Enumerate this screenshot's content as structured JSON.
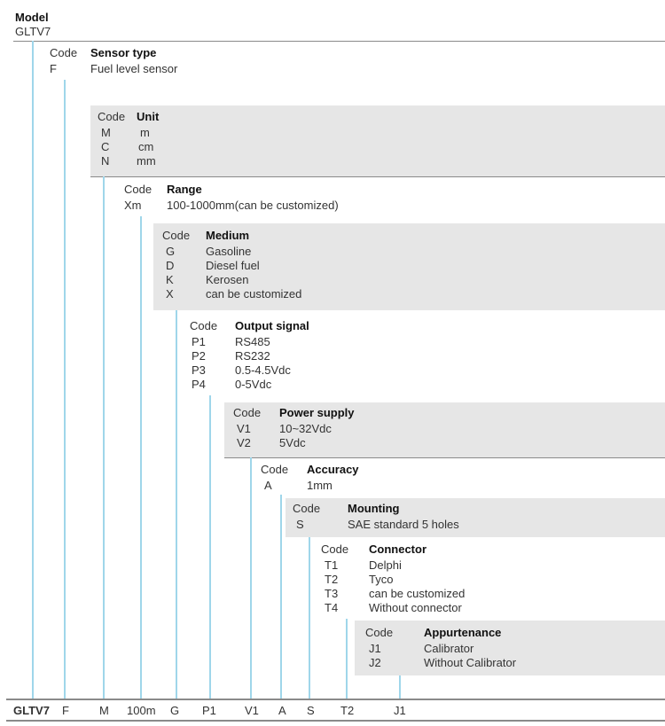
{
  "model": {
    "header": "Model",
    "value": "GLTV7"
  },
  "sections": {
    "sensor": {
      "code_h": "Code",
      "header": "Sensor type",
      "rows": [
        [
          "F",
          "Fuel level sensor"
        ]
      ]
    },
    "unit": {
      "code_h": "Code",
      "header": "Unit",
      "rows": [
        [
          "M",
          "m"
        ],
        [
          "C",
          "cm"
        ],
        [
          "N",
          "mm"
        ]
      ]
    },
    "range": {
      "code_h": "Code",
      "header": "Range",
      "rows": [
        [
          "Xm",
          "100-1000mm(can be customized)"
        ]
      ]
    },
    "medium": {
      "code_h": "Code",
      "header": "Medium",
      "rows": [
        [
          "G",
          "Gasoline"
        ],
        [
          "D",
          "Diesel fuel"
        ],
        [
          "K",
          "Kerosen"
        ],
        [
          "X",
          "can be customized"
        ]
      ]
    },
    "output": {
      "code_h": "Code",
      "header": "Output signal",
      "rows": [
        [
          "P1",
          "RS485"
        ],
        [
          "P2",
          "RS232"
        ],
        [
          "P3",
          "0.5-4.5Vdc"
        ],
        [
          "P4",
          "0-5Vdc"
        ]
      ]
    },
    "power": {
      "code_h": "Code",
      "header": "Power supply",
      "rows": [
        [
          "V1",
          "10~32Vdc"
        ],
        [
          "V2",
          "5Vdc"
        ]
      ]
    },
    "accuracy": {
      "code_h": "Code",
      "header": "Accuracy",
      "rows": [
        [
          "A",
          "1mm"
        ]
      ]
    },
    "mounting": {
      "code_h": "Code",
      "header": "Mounting",
      "rows": [
        [
          "S",
          "SAE standard 5 holes"
        ]
      ]
    },
    "connector": {
      "code_h": "Code",
      "header": "Connector",
      "rows": [
        [
          "T1",
          "Delphi"
        ],
        [
          "T2",
          "Tyco"
        ],
        [
          "T3",
          "can be customized"
        ],
        [
          "T4",
          "Without connector"
        ]
      ]
    },
    "appurt": {
      "code_h": "Code",
      "header": "Appurtenance",
      "rows": [
        [
          "J1",
          "Calibrator"
        ],
        [
          "J2",
          "Without  Calibrator"
        ]
      ]
    }
  },
  "example": {
    "model": "GLTV7",
    "sensor": "F",
    "unit": "M",
    "range": "100m",
    "medium": "G",
    "output": "P1",
    "power": "V1",
    "accuracy": "A",
    "mounting": "S",
    "connector": "T2",
    "appurt": "J1"
  }
}
